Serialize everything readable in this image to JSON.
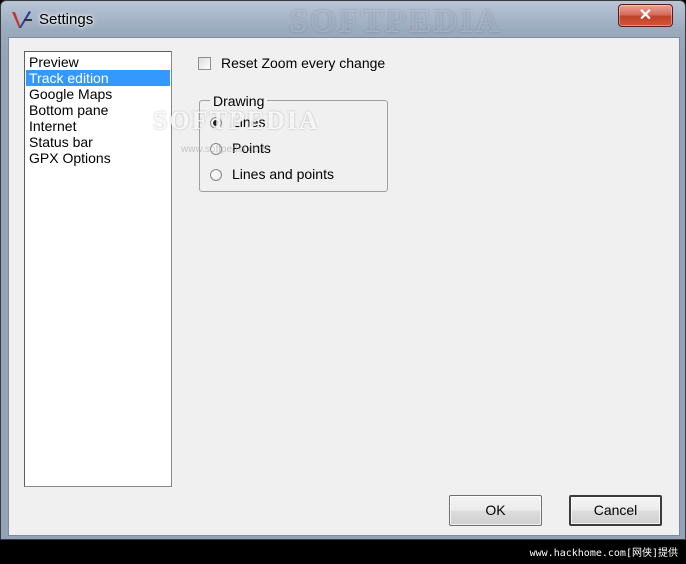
{
  "window": {
    "title": "Settings",
    "close_label": "✕",
    "watermark": "SOFTPEDIA"
  },
  "nav": {
    "items": [
      {
        "label": "Preview"
      },
      {
        "label": "Track edition",
        "selected": true
      },
      {
        "label": "Google Maps"
      },
      {
        "label": "Bottom pane"
      },
      {
        "label": "Internet"
      },
      {
        "label": "Status bar"
      },
      {
        "label": "GPX Options"
      }
    ]
  },
  "options": {
    "reset_zoom_label": "Reset Zoom every change",
    "reset_zoom_checked": false
  },
  "drawing": {
    "legend": "Drawing",
    "options": [
      {
        "label": "Lines",
        "checked": true
      },
      {
        "label": "Points",
        "checked": false
      },
      {
        "label": "Lines and points",
        "checked": false
      }
    ]
  },
  "watermark": {
    "text": "SOFTPEDIA",
    "url": "www.softpedia.com"
  },
  "buttons": {
    "ok_label": "OK",
    "cancel_label": "Cancel"
  },
  "footer": {
    "caption": "www.hackhome.com[网侠]提供"
  },
  "colors": {
    "selection": "#3399ff",
    "client_bg": "#f0f0f0",
    "close_button": "#c04127"
  },
  "icons": {
    "app": "app-logo-icon",
    "close": "close-icon"
  }
}
